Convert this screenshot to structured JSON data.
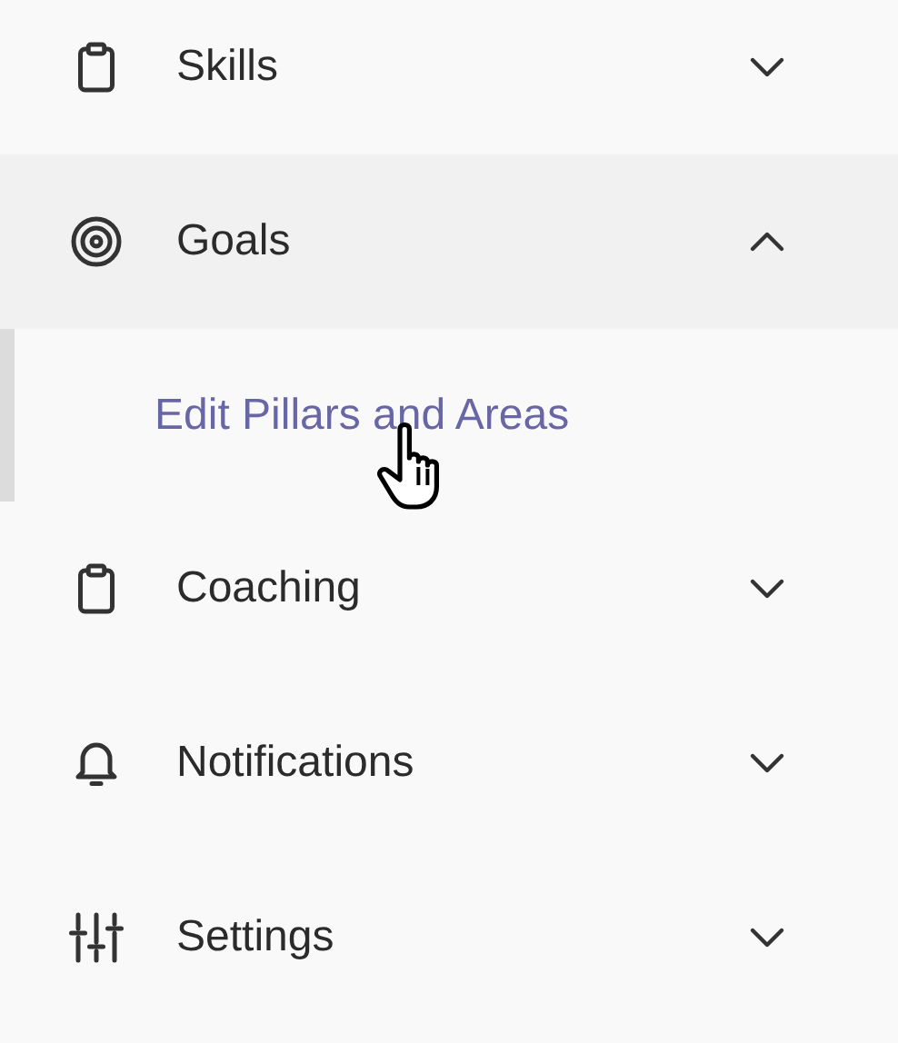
{
  "menu": [
    {
      "label": "Skills",
      "expanded": false
    },
    {
      "label": "Goals",
      "expanded": true,
      "children": [
        {
          "label": "Edit Pillars and Areas",
          "selected": true
        }
      ]
    },
    {
      "label": "Coaching",
      "expanded": false
    },
    {
      "label": "Notifications",
      "expanded": false
    },
    {
      "label": "Settings",
      "expanded": false
    }
  ]
}
